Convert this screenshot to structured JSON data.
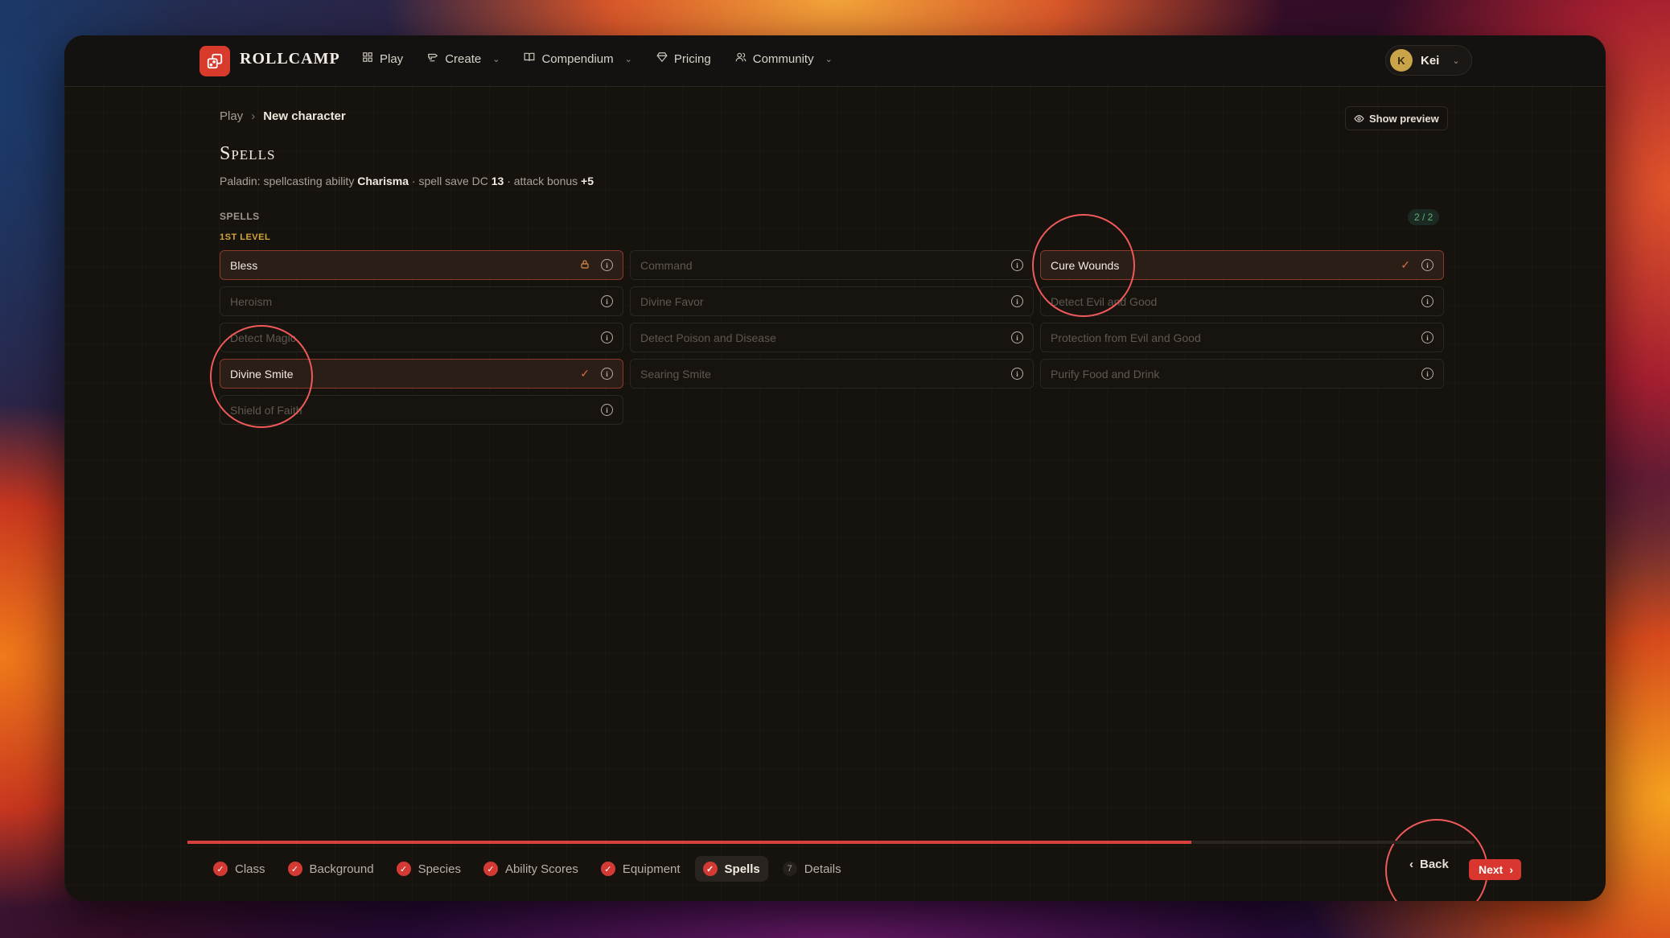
{
  "app": {
    "brand": "ROLLCAMP",
    "accent": "#d8362e"
  },
  "nav": [
    {
      "label": "Play",
      "icon": "grid-icon",
      "dropdown": false
    },
    {
      "label": "Create",
      "icon": "anvil-icon",
      "dropdown": true
    },
    {
      "label": "Compendium",
      "icon": "book-icon",
      "dropdown": true
    },
    {
      "label": "Pricing",
      "icon": "diamond-icon",
      "dropdown": false
    },
    {
      "label": "Community",
      "icon": "users-icon",
      "dropdown": true
    }
  ],
  "user": {
    "initial": "K",
    "name": "Kei"
  },
  "breadcrumb": {
    "root": "Play",
    "current": "New character"
  },
  "preview_button": "Show preview",
  "page": {
    "title": "Spells",
    "subtitle_prefix": "Paladin: spellcasting ability ",
    "ability": "Charisma",
    "subtitle_mid": " · spell save DC ",
    "dc": "13",
    "subtitle_mid2": " · attack bonus ",
    "attack": "+5"
  },
  "section_label": "SPELLS",
  "level_label": "1ST LEVEL",
  "counter": "2 / 2",
  "spells": [
    {
      "name": "Bless",
      "selected": true,
      "status": "lock"
    },
    {
      "name": "Command",
      "selected": false,
      "status": ""
    },
    {
      "name": "Cure Wounds",
      "selected": true,
      "status": "check"
    },
    {
      "name": "Heroism",
      "selected": false,
      "status": ""
    },
    {
      "name": "Divine Favor",
      "selected": false,
      "status": ""
    },
    {
      "name": "Detect Evil and Good",
      "selected": false,
      "status": ""
    },
    {
      "name": "Detect Magic",
      "selected": false,
      "status": ""
    },
    {
      "name": "Detect Poison and Disease",
      "selected": false,
      "status": ""
    },
    {
      "name": "Protection from Evil and Good",
      "selected": false,
      "status": ""
    },
    {
      "name": "Divine Smite",
      "selected": true,
      "status": "check"
    },
    {
      "name": "Searing Smite",
      "selected": false,
      "status": ""
    },
    {
      "name": "Purify Food and Drink",
      "selected": false,
      "status": ""
    },
    {
      "name": "Shield of Faith",
      "selected": false,
      "status": ""
    }
  ],
  "progress": 0.78,
  "steps": [
    {
      "label": "Class",
      "done": true,
      "active": false
    },
    {
      "label": "Background",
      "done": true,
      "active": false
    },
    {
      "label": "Species",
      "done": true,
      "active": false
    },
    {
      "label": "Ability Scores",
      "done": true,
      "active": false
    },
    {
      "label": "Equipment",
      "done": true,
      "active": false
    },
    {
      "label": "Spells",
      "done": true,
      "active": true
    },
    {
      "label": "Details",
      "done": false,
      "active": false,
      "number": "7"
    }
  ],
  "footer": {
    "back": "Back",
    "next": "Next"
  }
}
